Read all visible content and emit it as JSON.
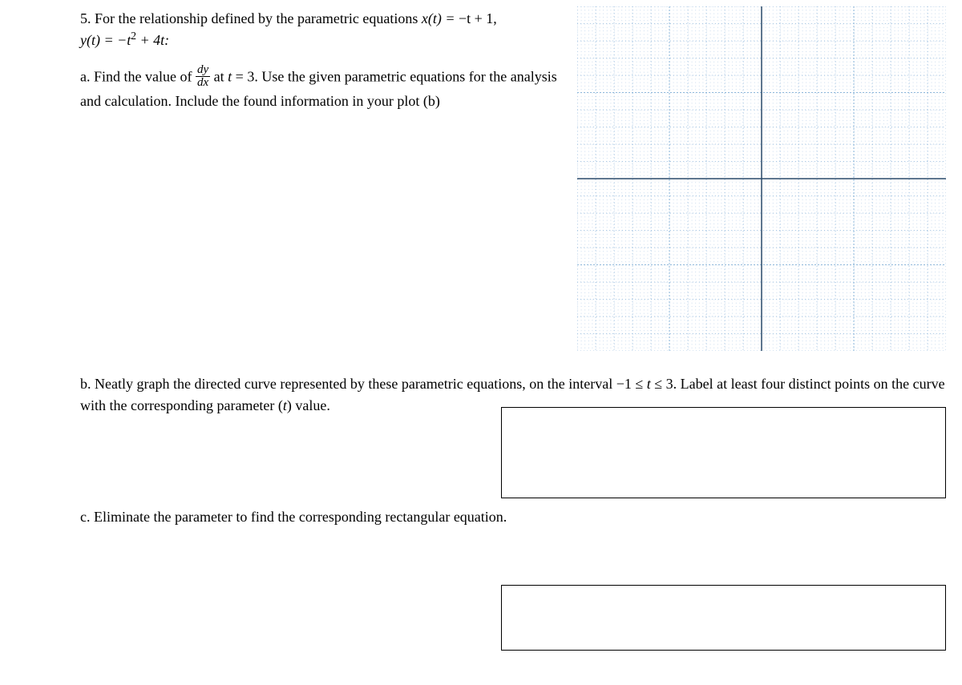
{
  "question": {
    "number": "5.",
    "intro_prefix": "For the relationship defined by the parametric equations ",
    "xt_lhs": "x(t) = ",
    "xt_rhs": "−t + 1,",
    "yt_lhs": "y(t) = ",
    "yt_rhs_a": "−t",
    "yt_exp": "2",
    "yt_rhs_b": " + 4t:",
    "part_a": {
      "label": "a.",
      "before_frac": "Find the value of ",
      "frac_num": "dy",
      "frac_den": "dx",
      "after_frac_1": " at ",
      "t_var": "t",
      "after_frac_2": " = 3. Use the given parametric equations for the analysis and calculation. Include the found information in your plot (b)"
    },
    "part_b": {
      "label": "b.",
      "text_before": "Neatly graph the directed curve represented by these parametric equations, on the interval −1 ≤ ",
      "t_var": "t",
      "text_mid": " ≤ 3. Label at least four distinct points on the curve with the corresponding parameter (",
      "t_var2": "t",
      "text_after": ") value."
    },
    "part_c": {
      "label": "c.",
      "text": "Eliminate the parameter to find the corresponding rectangular equation."
    }
  }
}
